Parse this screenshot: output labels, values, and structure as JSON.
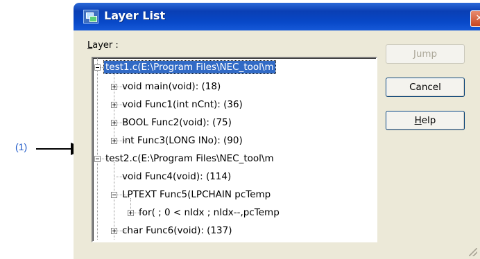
{
  "callout": {
    "label": "(1)"
  },
  "window": {
    "title": "Layer List",
    "close_glyph": "✕",
    "layer_label_first": "L",
    "layer_label_rest": "ayer :"
  },
  "tree": {
    "nodes": [
      {
        "text": "test1.c(E:\\Program Files\\NEC_tool\\m",
        "selected": true
      },
      {
        "text": "void main(void): (18)"
      },
      {
        "text": "void Func1(int nCnt): (36)"
      },
      {
        "text": "BOOL Func2(void): (75)"
      },
      {
        "text": "int Func3(LONG lNo): (90)"
      },
      {
        "text": "test2.c(E:\\Program Files\\NEC_tool\\m"
      },
      {
        "text": "void Func4(void): (114)"
      },
      {
        "text": "LPTEXT Func5(LPCHAIN pcTemp"
      },
      {
        "text": "for( ; 0 < nIdx ; nIdx--,pcTemp"
      },
      {
        "text": "char Func6(void): (137)"
      }
    ]
  },
  "buttons": {
    "jump": "Jump",
    "cancel": "Cancel",
    "help_first": "H",
    "help_rest": "elp"
  },
  "icons": [
    "app-icon",
    "close-icon",
    "expand-icon",
    "collapse-icon",
    "resize-grip-icon",
    "arrow-icon"
  ]
}
